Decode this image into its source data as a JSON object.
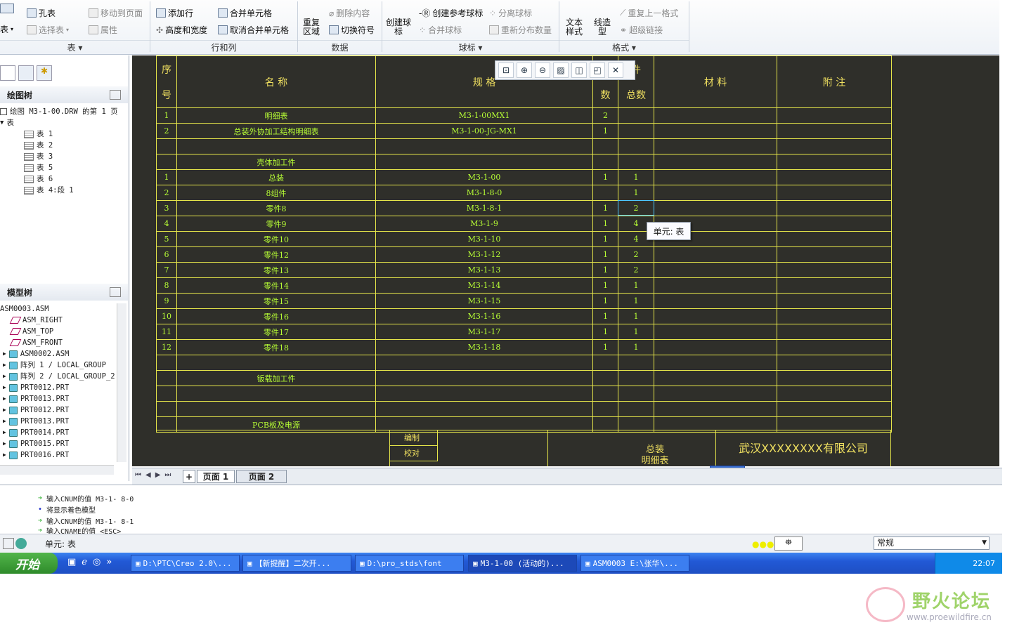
{
  "ribbon": {
    "col1": {
      "hole": "孔表",
      "select_table": "选择表",
      "table_frag": "表"
    },
    "col2": {
      "move_to_page": "移动到页面",
      "properties": "属性"
    },
    "rows_cols": {
      "add_row": "添加行",
      "height_width": "高度和宽度",
      "merge": "合并单元格",
      "unmerge": "取消合并单元格"
    },
    "data": {
      "repeat_region": "重复\n区域",
      "delete_content": "删除内容",
      "toggle_symbol": "切换符号"
    },
    "balloon": {
      "create_balloon": "创建球\n标",
      "create_ref_balloon": "创建参考球标",
      "merge_balloon": "合并球标",
      "detach_balloon": "分离球标",
      "redistribute": "重新分布数量"
    },
    "format": {
      "text_style": "文本\n样式",
      "line_style": "线造\n型",
      "repeat_last": "重复上一格式",
      "hyperlink": "超级链接"
    },
    "groups": {
      "table": "表",
      "rows_cols": "行和列",
      "data": "数据",
      "balloon": "球标",
      "format": "格式"
    }
  },
  "drawing_tree": {
    "title": "绘图树",
    "root": "绘图 M3-1-00.DRW 的第 1 页",
    "tables_node": "表",
    "items": [
      "表 1",
      "表 2",
      "表 3",
      "表 5",
      "表 6",
      "表 4:段 1"
    ]
  },
  "model_tree": {
    "title": "模型树",
    "root": "ASM0003.ASM",
    "items": [
      "ASM_RIGHT",
      "ASM_TOP",
      "ASM_FRONT",
      "ASM0002.ASM",
      "阵列 1 / LOCAL_GROUP",
      "阵列 2 / LOCAL_GROUP_2",
      "PRT0012.PRT",
      "PRT0013.PRT",
      "PRT0012.PRT",
      "PRT0013.PRT",
      "PRT0014.PRT",
      "PRT0015.PRT",
      "PRT0016.PRT"
    ]
  },
  "bom": {
    "headers": {
      "seq": "序\n\n号",
      "name": "名          称",
      "spec": "规            格",
      "qty": "数",
      "total": "件\n\n总数",
      "material": "材      料",
      "note": "附      注"
    },
    "rows": [
      [
        "1",
        "明细表",
        "M3-1-00MX1",
        "2",
        ""
      ],
      [
        "2",
        "总装外协加工结构明细表",
        "M3-1-00-JG-MX1",
        "1",
        ""
      ],
      [
        "",
        "",
        "",
        "",
        ""
      ],
      [
        "",
        "壳体加工件",
        "",
        "",
        ""
      ],
      [
        "1",
        "总装",
        "M3-1-00",
        "1",
        "1"
      ],
      [
        "2",
        "8组件",
        "M3-1-8-0",
        "",
        "1"
      ],
      [
        "3",
        "零件8",
        "M3-1-8-1",
        "1",
        "2"
      ],
      [
        "4",
        "零件9",
        "M3-1-9",
        "1",
        "4"
      ],
      [
        "5",
        "零件10",
        "M3-1-10",
        "1",
        "4"
      ],
      [
        "6",
        "零件12",
        "M3-1-12",
        "1",
        "2"
      ],
      [
        "7",
        "零件13",
        "M3-1-13",
        "1",
        "2"
      ],
      [
        "8",
        "零件14",
        "M3-1-14",
        "1",
        "1"
      ],
      [
        "9",
        "零件15",
        "M3-1-15",
        "1",
        "1"
      ],
      [
        "10",
        "零件16",
        "M3-1-16",
        "1",
        "1"
      ],
      [
        "11",
        "零件17",
        "M3-1-17",
        "1",
        "1"
      ],
      [
        "12",
        "零件18",
        "M3-1-18",
        "1",
        "1"
      ],
      [
        "",
        "",
        "",
        "",
        ""
      ],
      [
        "",
        "钣载加工件",
        "",
        "",
        ""
      ],
      [
        "",
        "",
        "",
        "",
        ""
      ],
      [
        "",
        "",
        "",
        "",
        ""
      ],
      [
        "",
        "PCB板及电源",
        "",
        "",
        ""
      ]
    ],
    "title_block": {
      "edit": "编制",
      "check": "校对",
      "drawing_name": "总装\n明细表",
      "company": "武汉XXXXXXXX有限公司"
    }
  },
  "tooltip": "单元: 表",
  "pages": [
    "页面 1",
    "页面 2"
  ],
  "messages": [
    "输入CNUM的值    M3-1- 8-0",
    "将显示着色模型",
    "输入CNUM的值    M3-1- 8-1",
    "输入CNAME的值    <ESC>"
  ],
  "status": {
    "text": "单元: 表",
    "filter": "常规"
  },
  "taskbar": {
    "start": "开始",
    "tasks": [
      "D:\\PTC\\Creo 2.0\\...",
      "【新提醒】二次开...",
      "D:\\pro_stds\\font",
      "M3-1-00 (活动的)...",
      "ASM0003 E:\\张华\\..."
    ],
    "clock": "22:07"
  },
  "watermark": {
    "name": "野火论坛",
    "url": "www.proewildfire.cn"
  }
}
